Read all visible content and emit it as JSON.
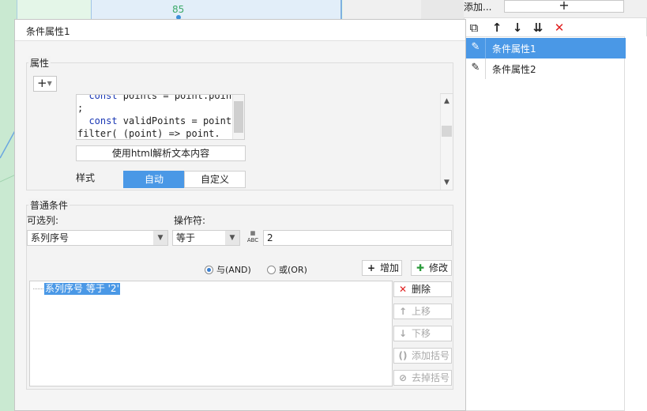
{
  "background": {
    "chart_label": "85"
  },
  "right_panel": {
    "add_label": "添加...",
    "add_button": "+",
    "toolbar": {
      "copy": "⧉",
      "up": "↑",
      "down": "↓",
      "sort": "⇊",
      "delete": "✕"
    },
    "items": [
      {
        "label": "条件属性1",
        "selected": true
      },
      {
        "label": "条件属性2",
        "selected": false
      }
    ]
  },
  "dialog": {
    "title": "条件属性1",
    "attributes": {
      "legend": "属性",
      "add_button": "+",
      "code_lines": [
        "  const points = point.points",
        ";",
        "  const validPoints = points.",
        "filter( (point) => point.",
        "  "
      ],
      "html_checkbox_label": "使用html解析文本内容",
      "style_label": "样式",
      "style_options": [
        "自动",
        "自定义"
      ],
      "style_selected": "自动"
    },
    "condition": {
      "legend": "普通条件",
      "column_label": "可选列:",
      "column_value": "系列序号",
      "operator_label": "操作符:",
      "operator_value": "等于",
      "operand_icon": "ABC",
      "value": "2",
      "and_label": "与(AND)",
      "or_label": "或(OR)",
      "logic_selected": "AND",
      "add_button": "增加",
      "modify_button": "修改",
      "list": [
        "系列序号 等于 '2'"
      ],
      "delete_button": "删除",
      "up_button": "上移",
      "down_button": "下移",
      "add_bracket_button": "添加括号",
      "remove_bracket_button": "去掉括号"
    }
  }
}
